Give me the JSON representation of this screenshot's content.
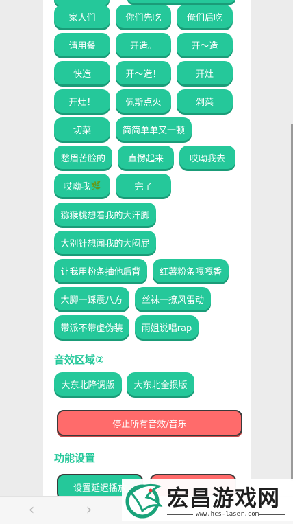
{
  "sound_buttons": [
    {
      "label": "家人们"
    },
    {
      "label": "你们先吃"
    },
    {
      "label": "俺们后吃"
    },
    {
      "label": "请用餐"
    },
    {
      "label": "开造。"
    },
    {
      "label": "开～造"
    },
    {
      "label": "快造"
    },
    {
      "label": "开～造！"
    },
    {
      "label": "开灶"
    },
    {
      "label": "开灶！"
    },
    {
      "label": "佩斯点火"
    },
    {
      "label": "剁菜"
    },
    {
      "label": "切菜"
    },
    {
      "label": "简简单单又一顿"
    },
    {
      "label": "愁眉苦脸的"
    },
    {
      "label": "直愣起来"
    },
    {
      "label": "哎呦我去"
    },
    {
      "label": "哎呦我"
    },
    {
      "label": "完了"
    },
    {
      "label": "猕猴桃想看我的大汗脚"
    },
    {
      "label": "大别针想闻我的大闷屁"
    },
    {
      "label": "让我用粉条抽他后背"
    },
    {
      "label": "红薯粉条嘎嘎香"
    },
    {
      "label": "大脚一踩震八方"
    },
    {
      "label": "丝袜一撩风雷动"
    },
    {
      "label": "带派不带虚伪装"
    },
    {
      "label": "雨姐说唱rap"
    }
  ],
  "section2": {
    "title": "音效区域②",
    "buttons": [
      {
        "label": "大东北降调版"
      },
      {
        "label": "大东北全损版"
      }
    ]
  },
  "stop_button": "停止所有音效/音乐",
  "settings": {
    "title": "功能设置",
    "delay_button": "设置延迟播放"
  },
  "watermark": {
    "title": "宏昌游戏网",
    "url": "www.hcs-laser.com"
  },
  "nav": {
    "back": "‹",
    "forward": "›"
  },
  "colors": {
    "accent": "#25c89a",
    "stop": "#ff6b6b"
  }
}
